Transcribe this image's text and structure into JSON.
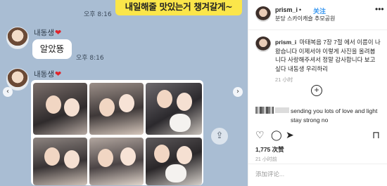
{
  "chat": {
    "top_bubble": "내일해줄 맛있는거 챙겨갈게~",
    "time_1": "오후 8:16",
    "sender_1": "내동생",
    "heart_1": "❤",
    "message": "알았뚕",
    "time_2": "오후 8:16",
    "sender_2": "내동생",
    "heart_2": "❤",
    "share_icon": "share-icon",
    "nav_left": "‹",
    "nav_right": "›"
  },
  "instagram": {
    "username": "prism_i",
    "separator": "•",
    "follow_label": "关注",
    "location": "분당 스카이캐슬 추모공원",
    "more_icon": "•••",
    "caption_user": "prism_i",
    "caption_text": "마태복음 7장 7절 에서 이름이 나왔습니다 이제서야 이렇게 사진을 올려봅니다 사랑해주셔서 정말 감사합니다 보고싶다 내동생 우리하리",
    "caption_time": "21 小时",
    "load_more": "+",
    "comment_text": "sending you lots of love and light stay strong no",
    "icons": {
      "heart": "♡",
      "comment": "◯",
      "share": "➤",
      "save": "⊓"
    },
    "likes": "1,775 次赞",
    "post_time": "21 小时前",
    "add_comment_placeholder": "添加评论..."
  },
  "colors": {
    "chat_background": "#a9bdd3",
    "yellow_bubble": "#fbe64a",
    "follow_blue": "#3897f0"
  }
}
